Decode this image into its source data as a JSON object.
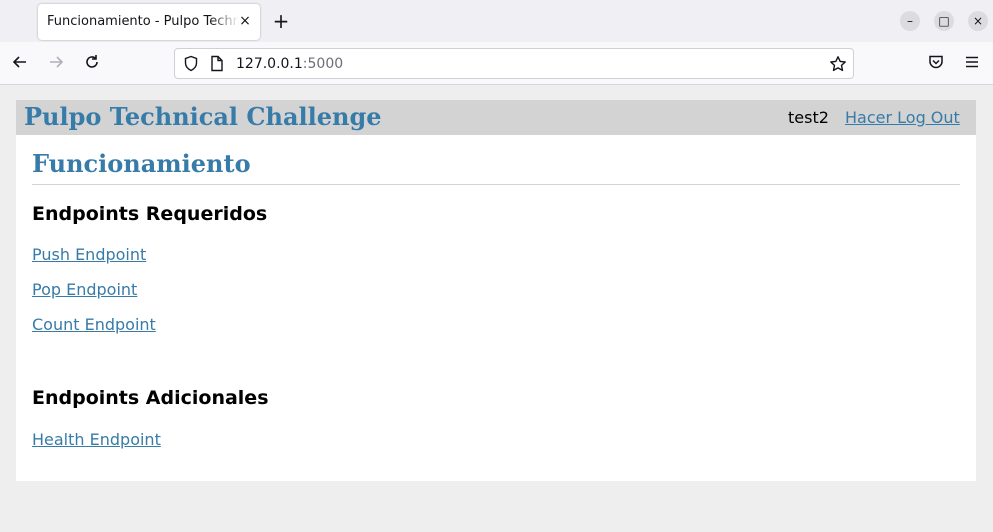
{
  "browser": {
    "tab_title": "Funcionamiento - Pulpo Technical Challenge",
    "tab_close": "×",
    "new_tab": "+",
    "url_host": "127.0.0.1",
    "url_port": ":5000",
    "window_buttons": {
      "minimize": "–",
      "maximize": "□",
      "close": "×"
    },
    "icons": {
      "back": "arrow-left-icon",
      "forward": "arrow-right-icon",
      "reload": "reload-icon",
      "shield": "shield-icon",
      "page": "page-icon",
      "bookmark": "star-icon",
      "pocket": "pocket-icon",
      "menu": "hamburger-menu-icon"
    }
  },
  "header": {
    "site_title": "Pulpo Technical Challenge",
    "username": "test2",
    "logout_label": "Hacer Log Out"
  },
  "main": {
    "page_title": "Funcionamiento",
    "sections": [
      {
        "heading": "Endpoints Requeridos",
        "links": [
          "Push Endpoint",
          "Pop Endpoint",
          "Count Endpoint"
        ]
      },
      {
        "heading": "Endpoints Adicionales",
        "links": [
          "Health Endpoint"
        ]
      }
    ]
  },
  "colors": {
    "accent": "#377ba8",
    "header_bg": "#d3d3d3",
    "page_bg": "#eeeeee",
    "content_bg": "#ffffff"
  }
}
